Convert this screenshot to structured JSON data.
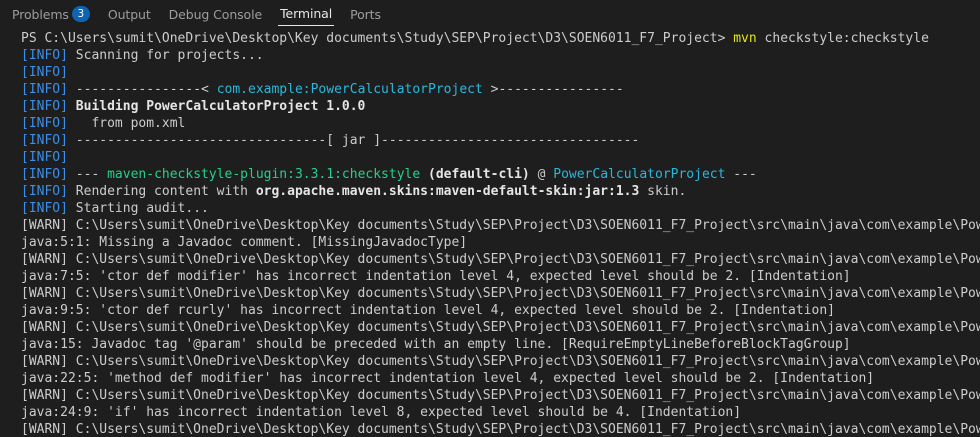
{
  "tabs": [
    {
      "label": "Problems",
      "badge": "3"
    },
    {
      "label": "Output"
    },
    {
      "label": "Debug Console"
    },
    {
      "label": "Terminal"
    },
    {
      "label": "Ports"
    }
  ],
  "colors": {
    "background": "#1e1e1e",
    "info_tag": "#3b8eea",
    "project_name": "#29b8db",
    "plugin": "#23d18b",
    "command": "#e5e510",
    "badge": "#0e63b3"
  },
  "terminal": {
    "lines": [
      [
        {
          "t": "PS C:\\Users\\sumit\\OneDrive\\Desktop\\Key documents\\Study\\SEP\\Project\\D3\\SOEN6011_F7_Project> "
        },
        {
          "t": "mvn",
          "c": "yellow"
        },
        {
          "t": " checkstyle:checkstyle"
        }
      ],
      [
        {
          "t": "[",
          "c": "tag"
        },
        {
          "t": "INFO",
          "c": "tag"
        },
        {
          "t": "]",
          "c": "tag"
        },
        {
          "t": " Scanning for projects..."
        }
      ],
      [
        {
          "t": "[INFO]",
          "c": "tag"
        }
      ],
      [
        {
          "t": "[INFO]",
          "c": "tag"
        },
        {
          "t": " ----------------< "
        },
        {
          "t": "com.example:PowerCalculatorProject",
          "c": "cyan"
        },
        {
          "t": " >----------------"
        }
      ],
      [
        {
          "t": "[INFO]",
          "c": "tag"
        },
        {
          "t": " "
        },
        {
          "t": "Building PowerCalculatorProject 1.0.0",
          "c": "bold"
        }
      ],
      [
        {
          "t": "[INFO]",
          "c": "tag"
        },
        {
          "t": "   from pom.xml"
        }
      ],
      [
        {
          "t": "[INFO]",
          "c": "tag"
        },
        {
          "t": " --------------------------------[ jar ]---------------------------------"
        }
      ],
      [
        {
          "t": "[INFO]",
          "c": "tag"
        }
      ],
      [
        {
          "t": "[INFO]",
          "c": "tag"
        },
        {
          "t": " --- "
        },
        {
          "t": "maven-checkstyle-plugin:3.3.1:checkstyle",
          "c": "green"
        },
        {
          "t": " "
        },
        {
          "t": "(default-cli)",
          "c": "bold"
        },
        {
          "t": " @ "
        },
        {
          "t": "PowerCalculatorProject",
          "c": "cyan"
        },
        {
          "t": " ---"
        }
      ],
      [
        {
          "t": "[INFO]",
          "c": "tag"
        },
        {
          "t": " Rendering content with "
        },
        {
          "t": "org.apache.maven.skins:maven-default-skin:jar:1.3",
          "c": "bold"
        },
        {
          "t": " skin."
        }
      ],
      [
        {
          "t": "[INFO]",
          "c": "tag"
        },
        {
          "t": " Starting audit..."
        }
      ],
      [
        {
          "t": "[WARN] C:\\Users\\sumit\\OneDrive\\Desktop\\Key documents\\Study\\SEP\\Project\\D3\\SOEN6011_F7_Project\\src\\main\\java\\com\\example\\PowerCalculator."
        }
      ],
      [
        {
          "t": "java:5:1: Missing a Javadoc comment. [MissingJavadocType]"
        }
      ],
      [
        {
          "t": "[WARN] C:\\Users\\sumit\\OneDrive\\Desktop\\Key documents\\Study\\SEP\\Project\\D3\\SOEN6011_F7_Project\\src\\main\\java\\com\\example\\PowerCalculator."
        }
      ],
      [
        {
          "t": "java:7:5: 'ctor def modifier' has incorrect indentation level 4, expected level should be 2. [Indentation]"
        }
      ],
      [
        {
          "t": "[WARN] C:\\Users\\sumit\\OneDrive\\Desktop\\Key documents\\Study\\SEP\\Project\\D3\\SOEN6011_F7_Project\\src\\main\\java\\com\\example\\PowerCalculator."
        }
      ],
      [
        {
          "t": "java:9:5: 'ctor def rcurly' has incorrect indentation level 4, expected level should be 2. [Indentation]"
        }
      ],
      [
        {
          "t": "[WARN] C:\\Users\\sumit\\OneDrive\\Desktop\\Key documents\\Study\\SEP\\Project\\D3\\SOEN6011_F7_Project\\src\\main\\java\\com\\example\\PowerCalculator."
        }
      ],
      [
        {
          "t": "java:15: Javadoc tag '@param' should be preceded with an empty line. [RequireEmptyLineBeforeBlockTagGroup]"
        }
      ],
      [
        {
          "t": "[WARN] C:\\Users\\sumit\\OneDrive\\Desktop\\Key documents\\Study\\SEP\\Project\\D3\\SOEN6011_F7_Project\\src\\main\\java\\com\\example\\PowerCalculator."
        }
      ],
      [
        {
          "t": "java:22:5: 'method def modifier' has incorrect indentation level 4, expected level should be 2. [Indentation]"
        }
      ],
      [
        {
          "t": "[WARN] C:\\Users\\sumit\\OneDrive\\Desktop\\Key documents\\Study\\SEP\\Project\\D3\\SOEN6011_F7_Project\\src\\main\\java\\com\\example\\PowerCalculator."
        }
      ],
      [
        {
          "t": "java:24:9: 'if' has incorrect indentation level 8, expected level should be 4. [Indentation]"
        }
      ],
      [
        {
          "t": "[WARN] C:\\Users\\sumit\\OneDrive\\Desktop\\Key documents\\Study\\SEP\\Project\\D3\\SOEN6011_F7_Project\\src\\main\\java\\com\\example\\PowerCalculator."
        }
      ]
    ]
  }
}
